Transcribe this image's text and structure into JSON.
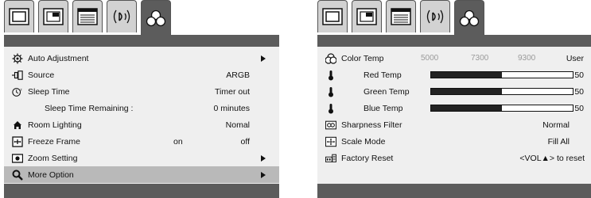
{
  "left_menu": {
    "tabs": [
      {
        "icon": "picture-tab-icon",
        "active": false
      },
      {
        "icon": "display-tab-icon",
        "active": false
      },
      {
        "icon": "setup-tab-icon",
        "active": false
      },
      {
        "icon": "audio-tab-icon",
        "active": false
      },
      {
        "icon": "option-tab-icon",
        "active": true
      }
    ],
    "items": [
      {
        "label": "Auto Adjustment",
        "value": "",
        "icon": "auto-adjustment-icon",
        "submenu": true
      },
      {
        "label": "Source",
        "value": "ARGB",
        "icon": "source-icon",
        "submenu": false
      },
      {
        "label": "Sleep Time",
        "value": "Timer out",
        "icon": "sleep-time-icon",
        "submenu": false
      },
      {
        "label": "Sleep Time Remaining :",
        "value": "0 minutes",
        "icon": "",
        "submenu": false
      },
      {
        "label": "Room Lighting",
        "value": "Nomal",
        "icon": "room-lighting-icon",
        "submenu": false
      },
      {
        "label": "Freeze Frame",
        "value": "off",
        "extra": "on",
        "icon": "freeze-frame-icon",
        "submenu": false
      },
      {
        "label": "Zoom Setting",
        "value": "",
        "icon": "zoom-setting-icon",
        "submenu": true
      },
      {
        "label": "More Option",
        "value": "",
        "icon": "more-option-icon",
        "submenu": true,
        "selected": true
      }
    ]
  },
  "right_menu": {
    "tabs": [
      {
        "icon": "picture-tab-icon",
        "active": false
      },
      {
        "icon": "display-tab-icon",
        "active": false
      },
      {
        "icon": "setup-tab-icon",
        "active": false
      },
      {
        "icon": "audio-tab-icon",
        "active": false
      },
      {
        "icon": "option-tab-icon",
        "active": true
      }
    ],
    "color_temp": {
      "label": "Color Temp",
      "presets": [
        "5000",
        "7300",
        "9300"
      ],
      "selected": "User"
    },
    "sliders": [
      {
        "label": "Red Temp",
        "value": "50",
        "fraction": 0.5
      },
      {
        "label": "Green Temp",
        "value": "50",
        "fraction": 0.5
      },
      {
        "label": "Blue Temp",
        "value": "50",
        "fraction": 0.5
      }
    ],
    "items": [
      {
        "label": "Sharpness Filter",
        "value": "Normal",
        "icon": "sharpness-filter-icon"
      },
      {
        "label": "Scale Mode",
        "value": "Fill All",
        "icon": "scale-mode-icon"
      },
      {
        "label": "Factory Reset",
        "value": "<VOL▲> to reset",
        "icon": "factory-reset-icon"
      }
    ]
  }
}
